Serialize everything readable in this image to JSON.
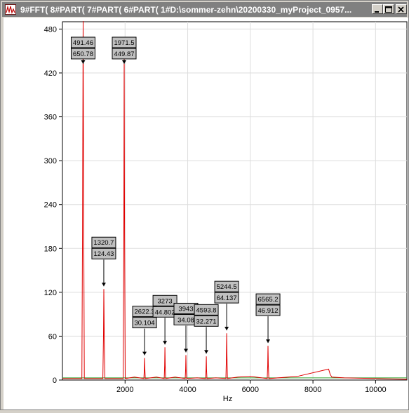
{
  "window": {
    "title": "9#FFT( 8#PART( 7#PART( 6#PART( 1#D:\\sommer-zehn\\20200330_myProject_0957..."
  },
  "icons": {
    "app": "chart-window-icon",
    "minimize": "minimize-icon",
    "maximize": "maximize-icon",
    "close": "close-icon"
  },
  "colors": {
    "spectrum": "#e00000",
    "baseline": "#2fa52f",
    "label_bg": "#c0c0c0",
    "grid": "#dddddd"
  },
  "chart_data": {
    "type": "line",
    "xlabel": "Hz",
    "ylabel": "",
    "xlim": [
      0,
      11000
    ],
    "ylim": [
      0,
      490
    ],
    "xticks": [
      2000,
      4000,
      6000,
      8000,
      10000
    ],
    "yticks": [
      0,
      60,
      120,
      180,
      240,
      300,
      360,
      420,
      480
    ],
    "grid": true,
    "series": [
      {
        "x": [
          0,
          620,
          640,
          660,
          680,
          700,
          1000,
          1290,
          1310,
          1320.7,
          1335,
          1355,
          1900,
          1940,
          1960,
          1971.5,
          1985,
          2005,
          2300,
          2600,
          2615,
          2622.3,
          2632,
          2645,
          3000,
          3250,
          3265,
          3273,
          3282,
          3295,
          3600,
          3920,
          3935,
          3943,
          3952,
          3965,
          4300,
          4570,
          4585,
          4593.8,
          4602,
          4615,
          4900,
          5220,
          5235,
          5244.5,
          5255,
          5270,
          5600,
          6000,
          6540,
          6555,
          6565.2,
          6575,
          6590,
          7500,
          8500,
          8550,
          8600,
          9000,
          10000,
          11000
        ],
        "y": [
          2,
          2,
          200,
          491,
          200,
          2,
          2,
          2,
          60,
          124.4,
          60,
          2,
          2,
          2,
          200,
          449.9,
          200,
          2,
          4,
          2,
          15,
          30.1,
          15,
          2,
          4,
          2,
          20,
          44.8,
          20,
          2,
          4,
          2,
          15,
          34.1,
          15,
          2,
          3,
          2,
          15,
          32.3,
          15,
          2,
          3,
          2,
          30,
          64.1,
          30,
          2,
          4,
          5,
          2,
          20,
          46.9,
          20,
          2,
          5,
          15,
          8,
          4,
          3,
          2,
          1
        ]
      },
      {
        "x": [
          0,
          11000
        ],
        "y": [
          3,
          3
        ]
      }
    ],
    "peaks": [
      {
        "freq": "491.46",
        "amp": "650.78",
        "x": 660,
        "y": 491
      },
      {
        "freq": "1971.5",
        "amp": "449.87",
        "x": 1971.5,
        "y": 449.87
      },
      {
        "freq": "1320.7",
        "amp": "124.43",
        "x": 1320.7,
        "y": 124.43
      },
      {
        "freq": "2622.3",
        "amp": "30.104",
        "x": 2622.3,
        "y": 30.104
      },
      {
        "freq": "3273",
        "amp": "44.802",
        "x": 3273,
        "y": 44.802
      },
      {
        "freq": "3943",
        "amp": "34.08",
        "x": 3943,
        "y": 34.08
      },
      {
        "freq": "4593.8",
        "amp": "32.271",
        "x": 4593.8,
        "y": 32.271
      },
      {
        "freq": "5244.5",
        "amp": "64.137",
        "x": 5244.5,
        "y": 64.137
      },
      {
        "freq": "6565.2",
        "amp": "46.912",
        "x": 6565.2,
        "y": 46.912
      }
    ]
  }
}
